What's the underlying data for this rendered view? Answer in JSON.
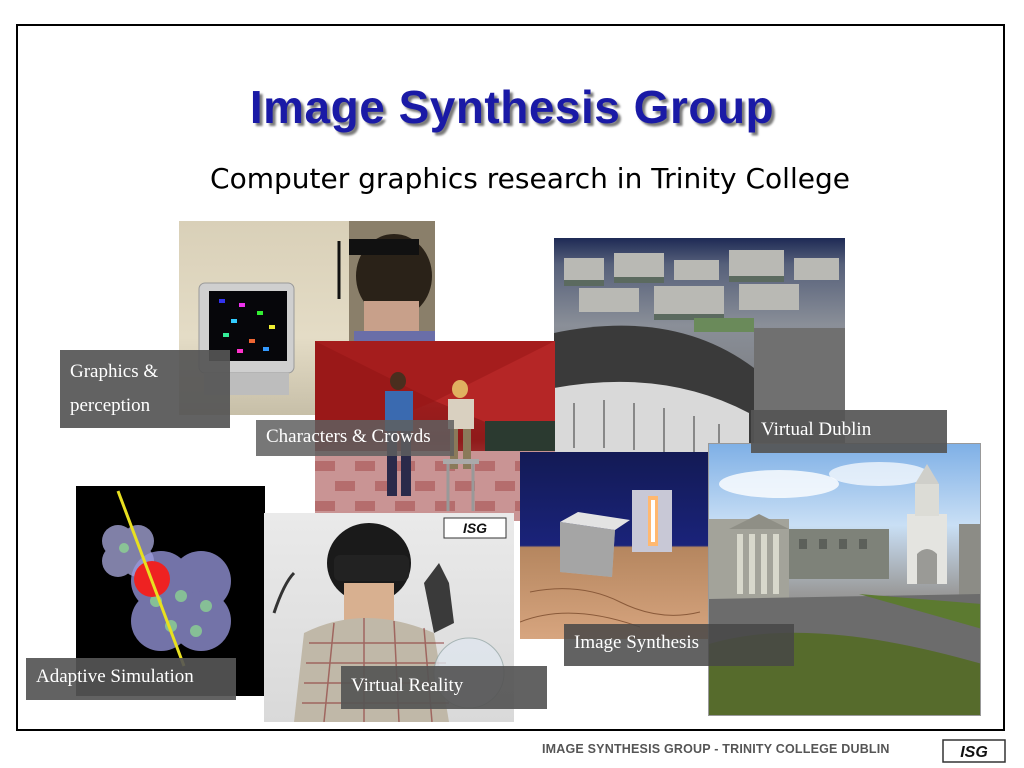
{
  "slide": {
    "title": "Image Synthesis Group",
    "subtitle": "Computer graphics research in Trinity College"
  },
  "labels": {
    "graphics_perception_line1": "Graphics &",
    "graphics_perception_line2": "perception",
    "characters_crowds": "Characters & Crowds",
    "virtual_dublin": "Virtual Dublin",
    "image_synthesis": "Image Synthesis",
    "adaptive_simulation": "Adaptive Simulation",
    "virtual_reality": "Virtual Reality"
  },
  "footer": {
    "text": "IMAGE SYNTHESIS GROUP - TRINITY COLLEGE DUBLIN",
    "logo": "ISG"
  },
  "colors": {
    "title": "#1a1aa6",
    "label_bg": "#555555",
    "footer_text": "#555555"
  }
}
